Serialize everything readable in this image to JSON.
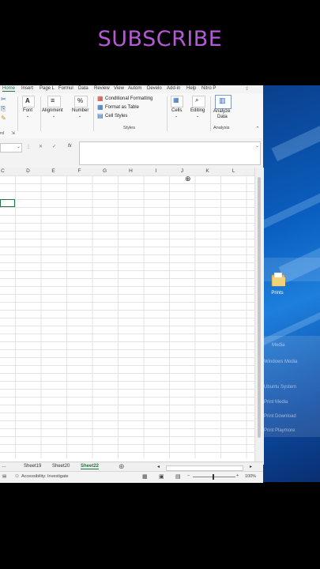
{
  "overlay": {
    "subscribe": "SUBSCRIBE"
  },
  "excel": {
    "tabs": [
      "Home",
      "Insert",
      "Page L",
      "Formul",
      "Data",
      "Review",
      "View",
      "Autom",
      "Develo",
      "Add-in",
      "Help",
      "Nitro P"
    ],
    "ribbon": {
      "font_label": "Font",
      "alignment_label": "Alignment",
      "number_label": "Number",
      "conditional_formatting": "Conditional Formatting",
      "format_as_table": "Format as Table",
      "cell_styles": "Cell Styles",
      "styles_group": "Styles",
      "cells_label": "Cells",
      "editing_label": "Editing",
      "analyze_data_line1": "Analyze",
      "analyze_data_line2": "Data",
      "analysis_group": "Analysis",
      "clipboard_fragment": "rd"
    },
    "formula_bar": {
      "fx": "fx",
      "value": ""
    },
    "columns": [
      "C",
      "D",
      "E",
      "F",
      "G",
      "H",
      "I",
      "J",
      "K",
      "L"
    ],
    "sheets": [
      "Sheet19",
      "Sheet20",
      "Sheet22"
    ],
    "active_sheet": "Sheet22",
    "status": {
      "accessibility": "Accessibility: Investigate",
      "zoom": "100%"
    }
  },
  "desktop": {
    "icon_label": "Prints",
    "ghost_items": [
      "Media",
      "Windows Media",
      "Ubuntu System",
      "Print Media",
      "Print Download",
      "Print Playmore"
    ]
  }
}
